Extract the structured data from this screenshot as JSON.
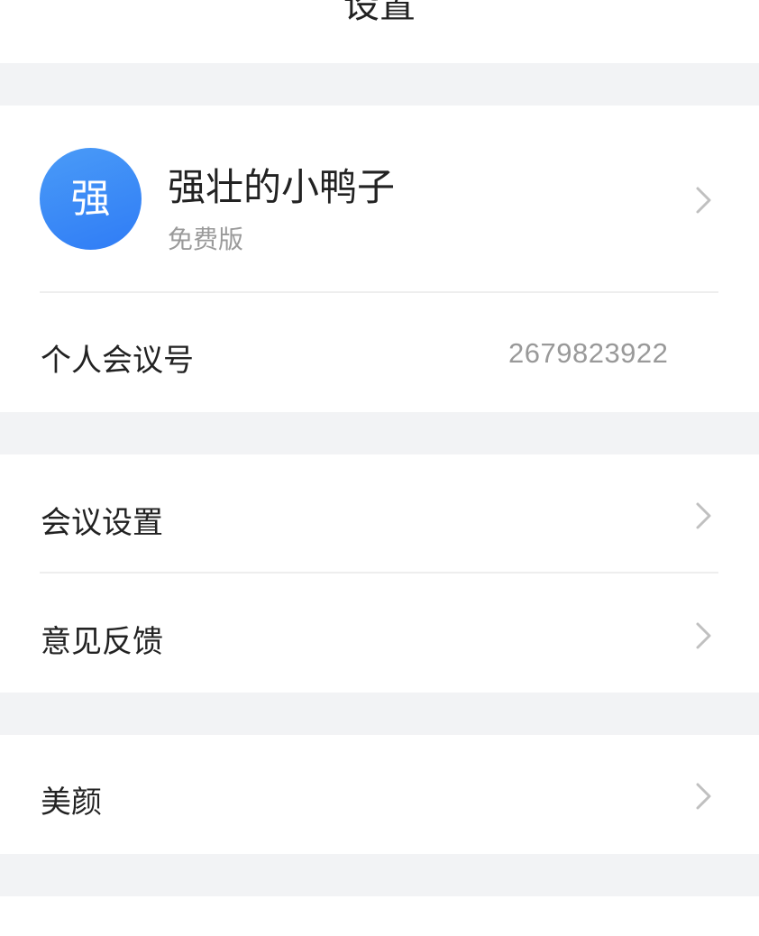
{
  "header": {
    "title": "设置"
  },
  "profile": {
    "avatar_char": "强",
    "name": "强壮的小鸭子",
    "plan": "免费版",
    "chevron_icon": "chevron-right-icon"
  },
  "meeting_id": {
    "label": "个人会议号",
    "value": "2679823922"
  },
  "menu": {
    "meeting_settings": "会议设置",
    "feedback": "意见反馈",
    "beauty": "美颜"
  },
  "colors": {
    "background": "#f2f3f5",
    "card": "#ffffff",
    "avatar": "#2f7cf6",
    "secondary_text": "#9a9a9a",
    "chevron": "#c0c0c0"
  }
}
